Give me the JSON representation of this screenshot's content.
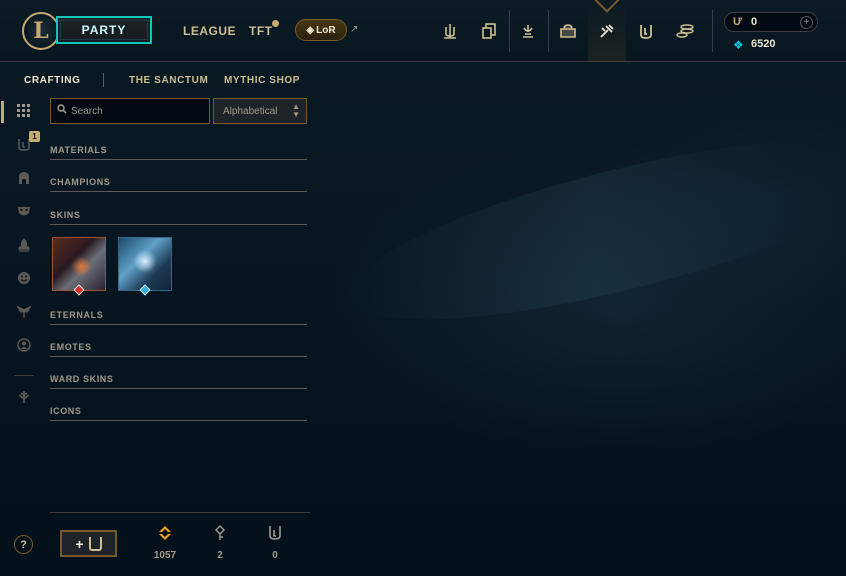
{
  "nav": {
    "party_label": "PARTY",
    "league_label": "LEAGUE",
    "tft_label": "TFT",
    "lor_label": "LoR",
    "icons": [
      "trophy-icon",
      "collection-icon",
      "profile-icon",
      "store-icon",
      "crafting-icon",
      "loot-icon",
      "coins-icon"
    ],
    "active_icon": "crafting-icon"
  },
  "wallet": {
    "rp_value": "0",
    "be_value": "6520"
  },
  "subtabs": {
    "crafting": "CRAFTING",
    "sanctum": "THE SANCTUM",
    "mythic_shop": "MYTHIC SHOP"
  },
  "rail": {
    "items": [
      "grid-icon",
      "chest-icon",
      "helmet-icon",
      "mask-icon",
      "flame-icon",
      "emote-icon",
      "ward-icon",
      "portrait-icon",
      "tft-icon"
    ],
    "chest_badge": "1"
  },
  "filter": {
    "search_placeholder": "Search",
    "sort_value": "Alphabetical"
  },
  "sections": {
    "materials": "MATERIALS",
    "champions": "CHAMPIONS",
    "skins": "SKINS",
    "eternals": "ETERNALS",
    "emotes": "EMOTES",
    "ward_skins": "WARD SKINS",
    "icons": "ICONS"
  },
  "skins": [
    {
      "rarity_color": "#d12d2d"
    },
    {
      "rarity_color": "#3aa8d8"
    }
  ],
  "footer": {
    "loot_button_label": "+",
    "orange_essence": "1057",
    "keys": "2",
    "chests": "0"
  },
  "colors": {
    "gold": "#c8aa6e",
    "accent_teal": "#0ac8b9",
    "background": "#010a13",
    "orange_essence": "#f0a020"
  }
}
